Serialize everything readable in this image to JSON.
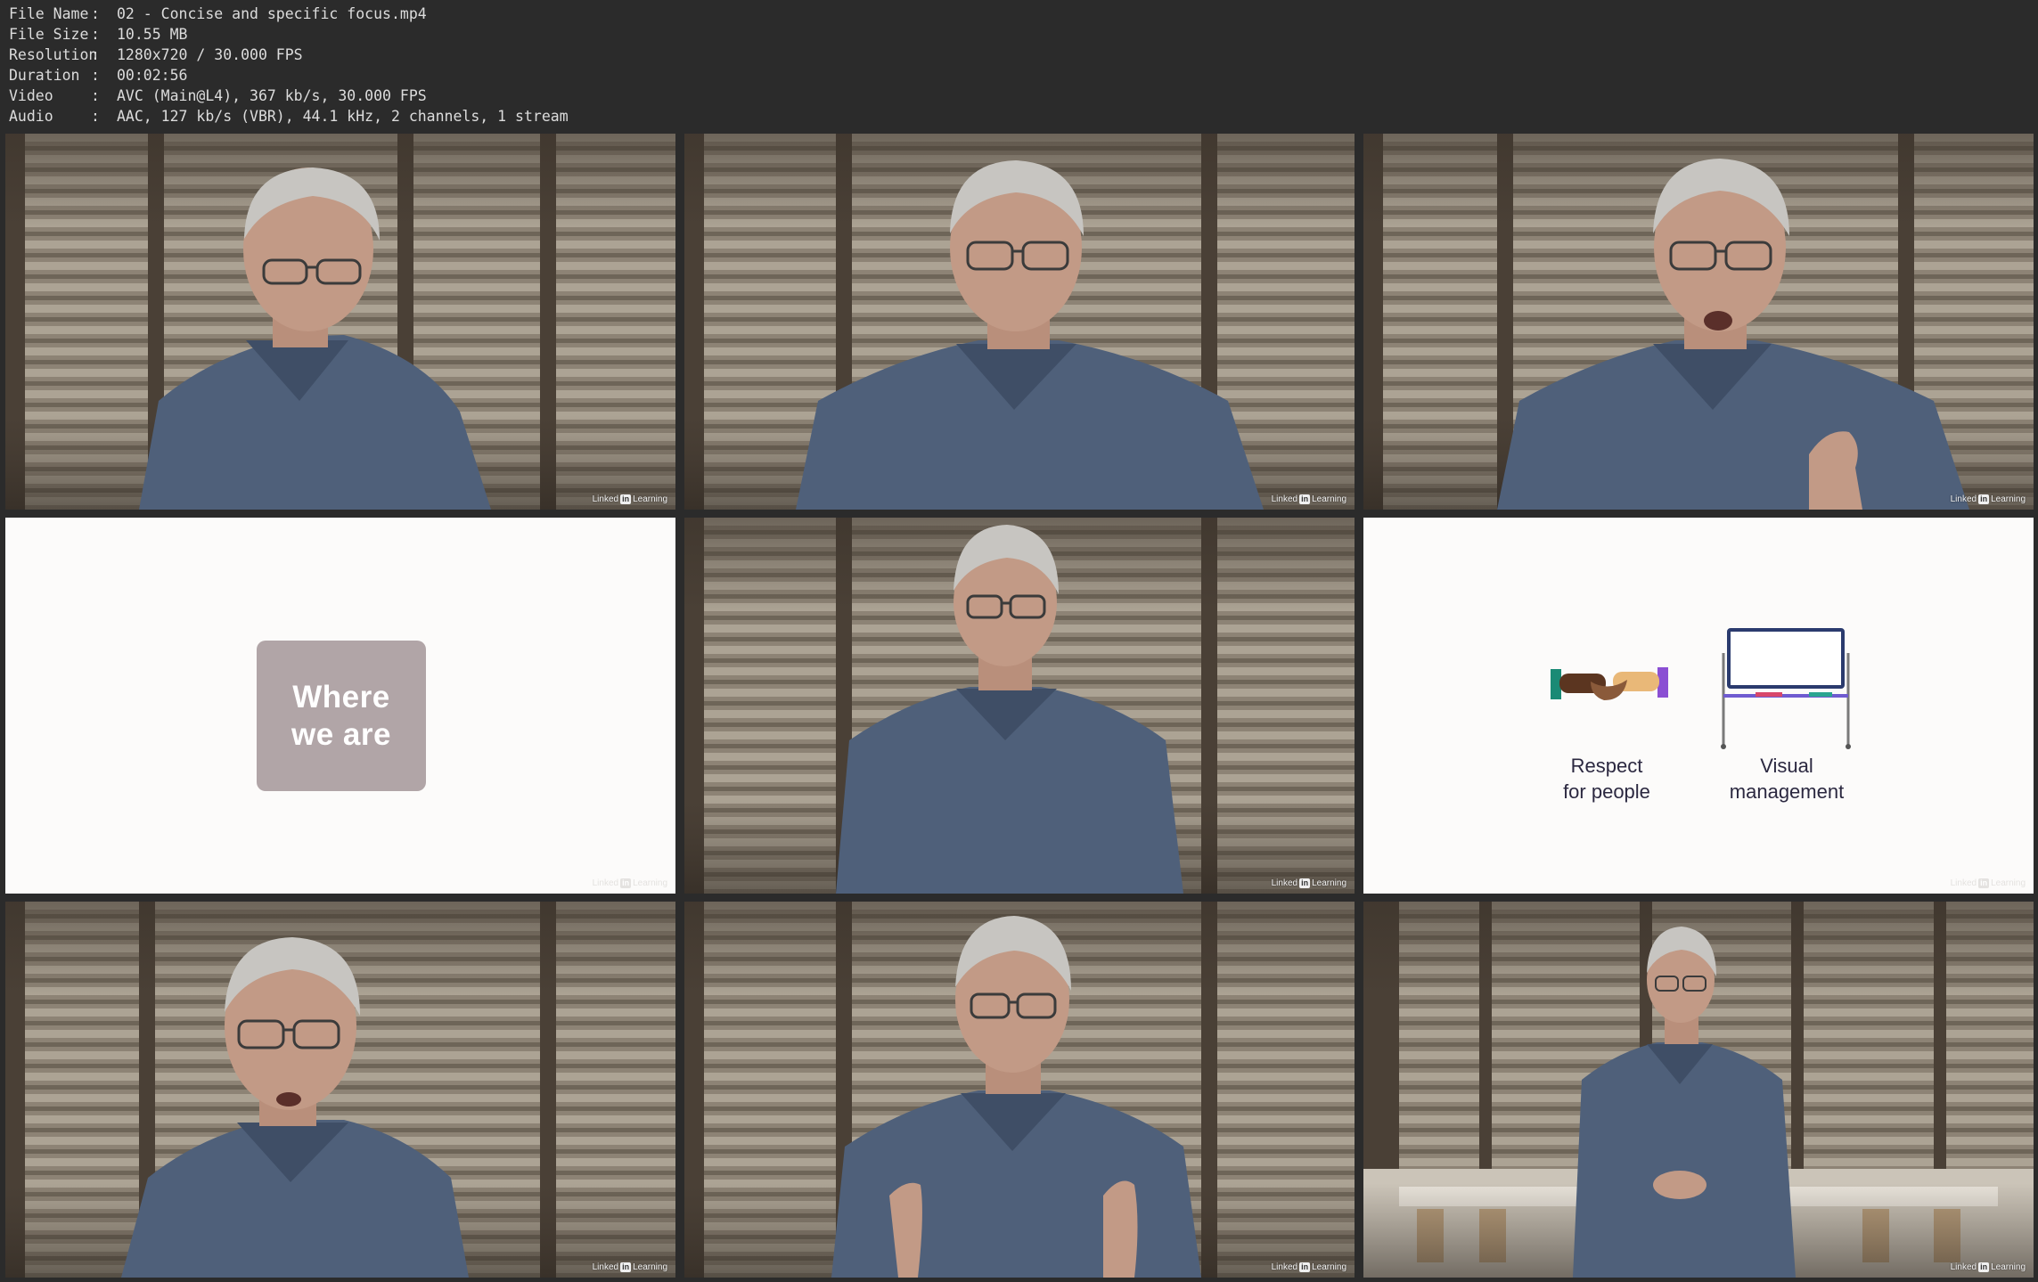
{
  "meta": [
    {
      "key": "File Name",
      "sep": ":",
      "value": "02 - Concise and specific focus.mp4"
    },
    {
      "key": "File Size",
      "sep": ":",
      "value": "10.55 MB"
    },
    {
      "key": "Resolution",
      "sep": ":",
      "value": "1280x720 / 30.000 FPS"
    },
    {
      "key": "Duration",
      "sep": ":",
      "value": "00:02:56"
    },
    {
      "key": "Video",
      "sep": ":",
      "value": "AVC (Main@L4), 367 kb/s, 30.000 FPS"
    },
    {
      "key": "Audio",
      "sep": ":",
      "value": "AAC, 127 kb/s (VBR), 44.1 kHz, 2 channels, 1 stream"
    }
  ],
  "watermark": {
    "linked": "Linked",
    "in": "in",
    "learning": "Learning"
  },
  "slides": {
    "where_box": "Where we are",
    "respect_label": "Respect for people",
    "visual_label": "Visual management"
  },
  "colors": {
    "background": "#2b2b2b",
    "shirt": "#4f607a",
    "where_box": "#b1a5a7",
    "slide_bg": "#fcfbfa"
  },
  "icons": [
    "handshake-icon",
    "whiteboard-icon"
  ]
}
